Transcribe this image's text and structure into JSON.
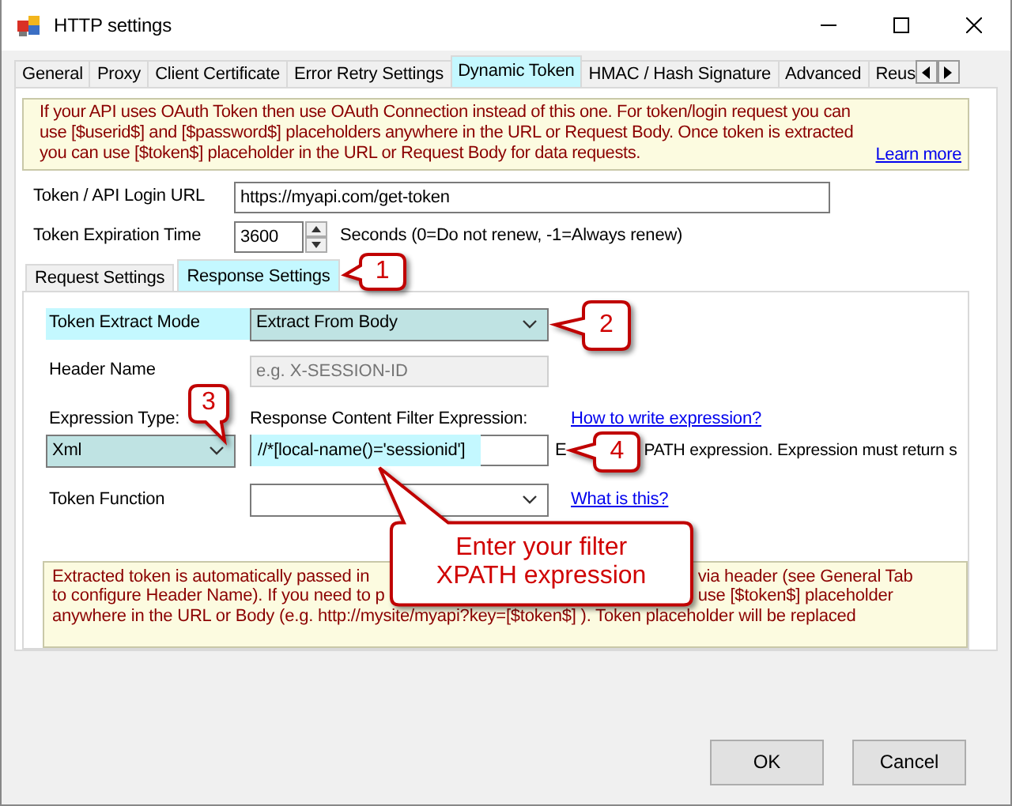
{
  "window": {
    "title": "HTTP settings"
  },
  "tabs": [
    {
      "label": "General",
      "selected": false
    },
    {
      "label": "Proxy",
      "selected": false
    },
    {
      "label": "Client Certificate",
      "selected": false
    },
    {
      "label": "Error Retry Settings",
      "selected": false
    },
    {
      "label": "Dynamic Token",
      "selected": true
    },
    {
      "label": "HMAC / Hash Signature",
      "selected": false
    },
    {
      "label": "Advanced",
      "selected": false
    },
    {
      "label": "Reus",
      "selected": false
    }
  ],
  "notice": {
    "text": "If your API uses OAuth Token then use OAuth Connection instead of this one. For token/login request you can use [$userid$] and [$password$] placeholders anywhere in the URL or Request Body. Once token is extracted you can use [$token$] placeholder in the URL or Request Body for data requests.",
    "link": "Learn more"
  },
  "login_url": {
    "label": "Token / API Login URL",
    "value": "https://myapi.com/get-token"
  },
  "expiration": {
    "label": "Token Expiration Time",
    "value": "3600",
    "hint": "Seconds (0=Do not renew, -1=Always renew)"
  },
  "subtabs": [
    {
      "label": "Request Settings",
      "selected": false
    },
    {
      "label": "Response Settings",
      "selected": true
    }
  ],
  "extract_mode": {
    "label": "Token Extract Mode",
    "label_highlighted": true,
    "value": "Extract From Body",
    "highlighted": true
  },
  "header_name": {
    "label": "Header Name",
    "placeholder": "e.g. X-SESSION-ID",
    "disabled": true
  },
  "expression_type": {
    "label": "Expression Type:",
    "value": "Xml",
    "highlighted": true
  },
  "filter_expression": {
    "label": "Response Content Filter Expression:",
    "value": "//*[local-name()='sessionid']",
    "highlighted": true,
    "help_link": "How to write expression?",
    "hint_fragments": [
      "E",
      "PATH expression. Expression must return s"
    ]
  },
  "token_function": {
    "label": "Token Function",
    "help_link": "What is this?"
  },
  "footer_note": {
    "lines": [
      [
        "Extracted token is automatically passed in",
        "via header (see General Tab"
      ],
      [
        "to configure Header Name). If you need to p",
        "use [$token$] placeholder"
      ],
      [
        "anywhere in the URL or Body (e.g. http://mysite/myapi?key=[$token$] ). Token placeholder will be replaced"
      ]
    ]
  },
  "buttons": [
    "OK",
    "Cancel"
  ],
  "callouts": [
    {
      "kind": "number",
      "text": "1"
    },
    {
      "kind": "number",
      "text": "2"
    },
    {
      "kind": "number",
      "text": "3"
    },
    {
      "kind": "number",
      "text": "4"
    },
    {
      "kind": "speech",
      "text": "Enter your filter XPATH expression"
    }
  ]
}
